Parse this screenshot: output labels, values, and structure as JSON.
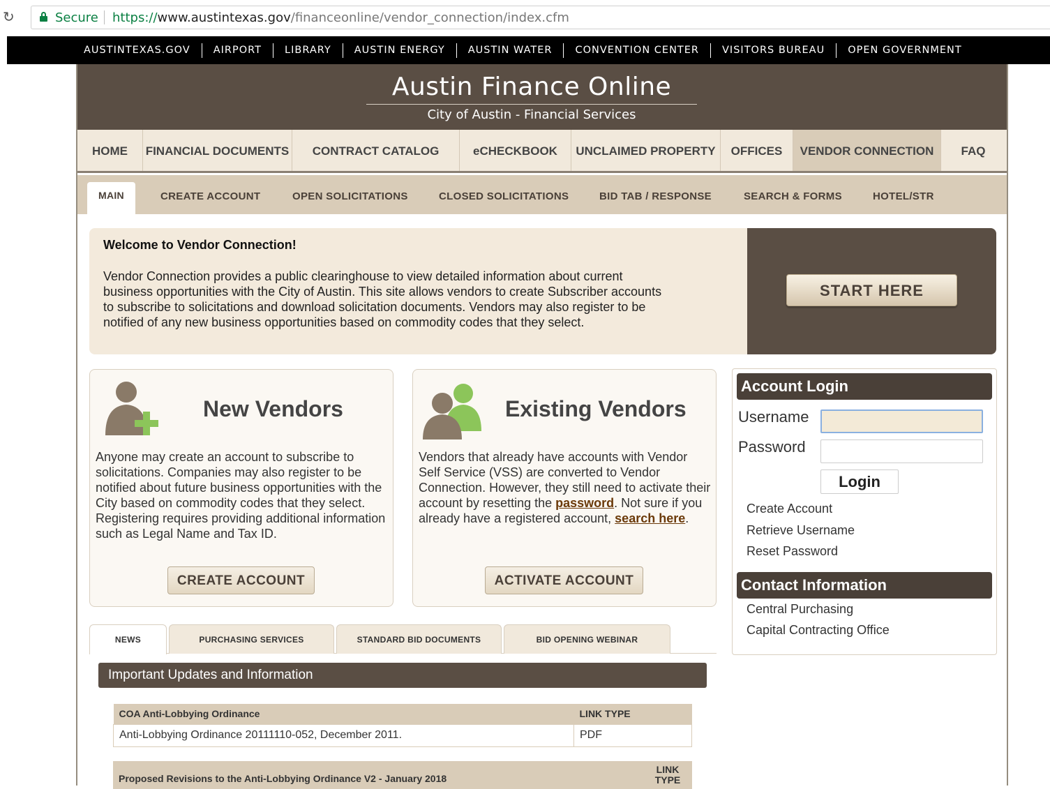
{
  "browser": {
    "secure_label": "Secure",
    "url_scheme": "https://",
    "url_host": "www.austintexas.gov",
    "url_path": "/financeonline/vendor_connection/index.cfm"
  },
  "topbar": [
    "AUSTINTEXAS.GOV",
    "AIRPORT",
    "LIBRARY",
    "AUSTIN ENERGY",
    "AUSTIN WATER",
    "CONVENTION CENTER",
    "VISITORS BUREAU",
    "OPEN GOVERNMENT"
  ],
  "header": {
    "title": "Austin Finance Online",
    "subtitle": "City of Austin - Financial Services"
  },
  "mainnav": [
    "HOME",
    "FINANCIAL DOCUMENTS",
    "CONTRACT CATALOG",
    "eCHECKBOOK",
    "UNCLAIMED PROPERTY",
    "OFFICES",
    "VENDOR CONNECTION",
    "FAQ"
  ],
  "subnav": [
    "MAIN",
    "CREATE ACCOUNT",
    "OPEN SOLICITATIONS",
    "CLOSED SOLICITATIONS",
    "BID TAB / RESPONSE",
    "SEARCH & FORMS",
    "HOTEL/STR"
  ],
  "welcome": {
    "heading": "Welcome to Vendor Connection!",
    "line1": "Vendor Connection provides a public clearinghouse to view detailed information about current",
    "line2": "business opportunities with the City of Austin. This site allows vendors to create Subscriber accounts",
    "line3": "to subscribe to solicitations and download solicitation documents. Vendors may also register to be",
    "line4": "notified of any new business opportunities based on commodity codes that they select.",
    "start_button": "START HERE"
  },
  "new_vendors": {
    "title": "New Vendors",
    "text": "Anyone may create an account to subscribe to solicitations. Companies may also register to be notified about future business opportunities with the City based on commodity codes that they select. Registering requires providing additional information such as Legal Name and Tax ID.",
    "button": "CREATE ACCOUNT"
  },
  "existing_vendors": {
    "title": "Existing Vendors",
    "text_a": "Vendors that already have accounts with Vendor Self Service (VSS) are converted to Vendor Connection. However, they still need to activate their account by resetting the ",
    "link_password": "password",
    "text_b": ". Not sure if you already have a registered account, ",
    "link_search": "search here",
    "text_c": ".",
    "button": "ACTIVATE ACCOUNT"
  },
  "login": {
    "heading": "Account Login",
    "username_label": "Username",
    "password_label": "Password",
    "username_value": "",
    "password_value": "",
    "login_button": "Login",
    "links": [
      "Create Account",
      "Retrieve Username",
      "Reset Password"
    ]
  },
  "contact": {
    "heading": "Contact Information",
    "links": [
      "Central Purchasing",
      "Capital Contracting Office"
    ]
  },
  "tabs": [
    "NEWS",
    "PURCHASING SERVICES",
    "STANDARD BID DOCUMENTS",
    "BID OPENING WEBINAR"
  ],
  "updates": {
    "heading": "Important Updates and Information",
    "tables": [
      {
        "title": "COA Anti-Lobbying Ordinance",
        "type_header": "LINK TYPE",
        "row": "Anti-Lobbying Ordinance 20111110-052, December 2011.",
        "type": "PDF"
      },
      {
        "title": "Proposed Revisions to the Anti-Lobbying Ordinance V2 - January 2018",
        "type_header_1": "LINK",
        "type_header_2": "TYPE"
      }
    ]
  },
  "colors": {
    "brown_dark": "#5a4e44",
    "tan": "#f1e9dc",
    "subnav_tan": "#d9ccb8",
    "secure_green": "#0b8043"
  }
}
